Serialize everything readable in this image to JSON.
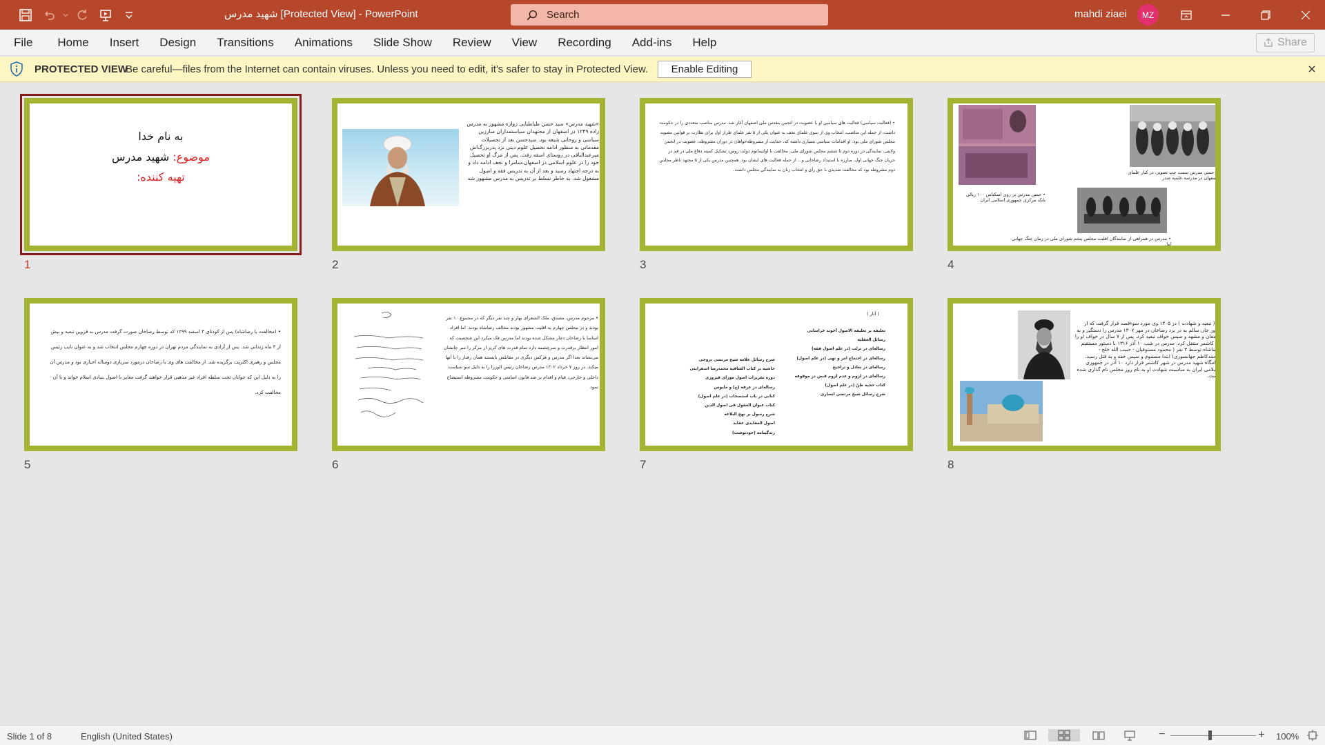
{
  "window": {
    "title": "شهید مدرس  [Protected View]  -  PowerPoint",
    "search_placeholder": "Search",
    "user_name": "mahdi ziaei",
    "user_initials": "MZ",
    "accent_color": "#b7472a"
  },
  "ribbon": {
    "tabs": [
      "File",
      "Home",
      "Insert",
      "Design",
      "Transitions",
      "Animations",
      "Slide Show",
      "Review",
      "View",
      "Recording",
      "Add-ins",
      "Help"
    ],
    "share_label": "Share"
  },
  "protected_view": {
    "title": "PROTECTED VIEW",
    "message": "Be careful—files from the Internet can contain viruses. Unless you need to edit, it's safer to stay in Protected View.",
    "enable_button": "Enable Editing"
  },
  "slides": [
    {
      "number": "1",
      "line1": "به نام خدا",
      "line2_label": "موضوع:",
      "line2_value": " شهید مدرس",
      "line3": "تهیه کننده:"
    },
    {
      "number": "2",
      "text": "«شهید مدرس» سید حسن طباطبایی زواره مشهور به مدرس زاده ۱۲۴۹ در اصفهان از مجتهدان سیاستمداران مبارزین سیاسی و روحانی شیعه بود. سیدحسن بعد از تحصیلات مقدماتی به منظور ادامه تحصیل علوم دینی نزد پدربزرگ‌اش میرعبدالباقی در روستای اسفه رفت. پس از مرگ او تحصیل خود را در علوم اسلامی در اصفهان،سامرا و نجف ادامه داد و به درجه اجتهاد رسید و بعد از آن به تدریس فقه و اصول مشغول شد. به خاطر تسلط بر تدریس به مدرس مشهور شد"
    },
    {
      "number": "3",
      "text": "• (فعالیت سیاسی) فعالیت های سیاسی او با عضویت در انجمن مقدس ملی اصفهان آغاز شد. مدرس مناصب متعددی را در حکومت داشت، از جمله این مناصب، انتخاب وی از سوی علمای نجف به عنوان یکی از ۵ نفر علمای طراز اول برای نظارت بر قوانین مصوبه مجلس شورای ملی بود. او اقدامات سیاسی بسیاری داشته که، حمایت از مشروطه‌خواهان در دوران مشروطه، عضویت در انجمن ولایتی، نمایندگی در دوره دوم تا ششم مجلس شورای ملی، مخالفت با اولتیماتوم دولت روس، تشکیل کمیته دفاع ملی در قم در جریان جنگ جهانی اول، مبارزه با استبداد رضاخانی و... از جمله فعالیت های ایشان بود. همچنین مدرس یکی از ۵ مجتهد ناظر مجلس دوم مشروطه بود که مخالفت شدیدی با حق رأی و انتخاب زنان به نمایندگی مجلس داشت."
    },
    {
      "number": "4",
      "caption1": "• حسن مدرس سمت چپ تصویر، در کنار علمای اصفهان در مدرسه علمیه صدر",
      "caption2": "• حسن مدرس بر روی اسکناس ۱۰۰ ریالی بانک مرکزی جمهوری اسلامی ایران",
      "caption3": "• مدرس در همراهی از نمایندگان اقلیت مجلس پنجم شورای ملی در زمان جنگ جهانی اول"
    },
    {
      "number": "5",
      "text": "• (مخالفت با رضاشاه) پس از کودتای ۳ اسفند ۱۲۹۹ که توسط رضاخان صورت گرفت مدرس به قزوین تبعید و بیش از ۳ ماه زندانی شد. پس از آزادی به نمایندگی مردم تهران در دوره چهارم مجلس انتخاب شد و به عنوان نایب رئیس مجلس و رهبری اکثریت برگزیده شد. از مخالفت های وی با رضاخان درمورد سربازی دوساله اجباری بود و مدرس آن را به دلیل این که جوانان تحت سلطه افراد غیر مذهبی قرار خواهند گرفت مغایر با اصول بنیادی اسلام خواند و با آن مخالفت کرد."
    },
    {
      "number": "6",
      "text": "• مرحوم مدرس، مصدق، ملک الشعرای بهار و چند نفر دیگر که در مجموع ۱۰ نفر بودند و در مجلس چهارم به اقلیت مشهور بودند مخالف رضاشاه بودند. اما افراد اساسا با رضاخان دچار مشکل شده بودند اما مدرس فک میکرد این شخصیت که امور انتظار برقدرت و سرچشمه دارد تمام قدرت های کریز از مرکز را سر جانشان می‌نشاند بعدا اگر مدرس و هرکس دیگری در مقابلش بایستند همان رفتار را با آنها میکند. در روز ۷ خرداد ۱۳۰۲ مدرس رضاخان رئیس الوزرا را به دلیل سو سیاست داخلی و خارجی، قیام و اقدام بر ضد قانون اساسی و حکومت مشروطه استیضاح نمود"
    },
    {
      "number": "7",
      "heading": "( آثار )",
      "col_right": [
        "تعلیقه بر تعلیقه الاصول آخوند خراسانی",
        "رسائل العقلیه",
        "رساله‌ای در ترتّب (در علم اصول فقه)",
        "رساله‌ای در اجتماع امر و نهی (در علم اصول)",
        "رساله‌ای در تعادل و تراجیح",
        "رساله‌ای در لزوم و عدم لزوم قبض در موقوفه",
        "کتاب حجیه ظنّ (در علم اصول)",
        "شرح رسائل شیخ مرتضی انصاری"
      ],
      "col_left": [
        "شرح رسائل علامه شیخ مرتضی بروجی",
        "حاشیه بر کتاب الشافیه محمدرضا اسفراینی",
        "دوره تقریرات اصول موزای فیروزی",
        "رساله‌ای در عرفه (ح) و ملبوس",
        "کتابی در باب استصحاب (در علم اصول)",
        "کتاب عنوان العقول فی اصول الدین",
        "شرح رسول بر نهج البلاغه",
        "اصول العقایدی عقاید",
        "زندگینامه (خودنوشت)"
      ]
    },
    {
      "number": "8",
      "text": "• ( تبعید و شهادت ) در ۱۳۰۵ وی مورد سوءقصد قرار گرفت که از ترور جان سالم به در برد رضاخان در مهر ۱۳۰۷ مدرس را دستگیر و به دامغان و مشهد و سپس خواف تبعید کرد. پس از ۷ سال در خواف او را به کاشمر منتقل کرد. مدرس در شب ۱۰ آذر ۱۳۱۶ با دستور مستقیم رضاشاه توسط ۳ نفر ( محمود مستوفیان - حبیب الله خلج - محمدکاظم جهانسوزی) ابتدا مسموم و سپس خفه و به قتل رسید. آرامگاه شهید مدرس در شهر کاشمر قرار دارد ۱۰ آذر در جمهوری اسلامی ایران به مناسبت شهادت او به نام روز مجلس نام گذاری شده است."
    }
  ],
  "status": {
    "slide_counter": "Slide 1 of 8",
    "language": "English (United States)",
    "zoom": "100%"
  }
}
